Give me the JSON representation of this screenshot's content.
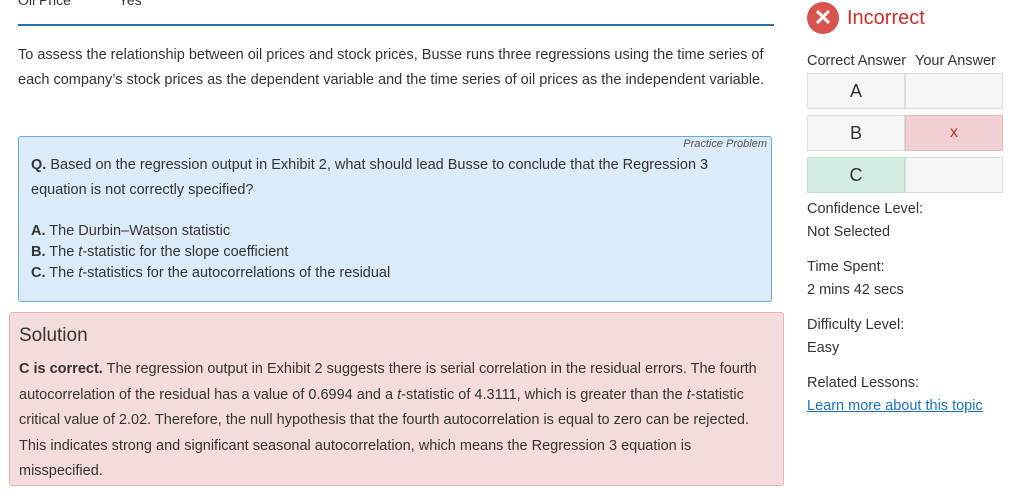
{
  "table_top": {
    "col1": "Oil Price",
    "col2": "Yes"
  },
  "intro": "To assess the relationship between oil prices and stock prices, Busse runs three regressions using the time series of each company’s stock prices as the dependent variable and the time series of oil prices as the independent variable.",
  "question": {
    "tag": "Practice Problem",
    "prefix": "Q.",
    "text": "Based on the regression output in Exhibit 2, what should lead Busse to conclude that the Regression 3 equation is not correctly specified?",
    "options": [
      {
        "letter": "A.",
        "pre": "The Durbin–Watson statistic",
        "t": "",
        "post": ""
      },
      {
        "letter": "B.",
        "pre": "The ",
        "t": "t",
        "post": "-statistic for the slope coefficient"
      },
      {
        "letter": "C.",
        "pre": "The ",
        "t": "t",
        "post": "-statistics for the autocorrelations of the residual"
      }
    ]
  },
  "solution": {
    "title": "Solution",
    "lead": "C is correct.",
    "s1": " The regression output in Exhibit 2 suggests there is serial correlation in the residual errors. The fourth autocorrelation of the residual has a value of 0.6994 and a ",
    "t1": "t",
    "s2": "-statistic of 4.3111, which is greater than the ",
    "t2": "t",
    "s3": "-statistic critical value of 2.02. Therefore, the null hypothesis that the fourth autocorrelation is equal to zero can be rejected. This indicates strong and significant seasonal autocorrelation, which means the Regression 3 equation is misspecified."
  },
  "sidebar": {
    "result": {
      "icon": "✕",
      "label": "Incorrect",
      "color": "#c9302c"
    },
    "correct_header": "Correct Answer",
    "your_header": "Your Answer",
    "answers": [
      {
        "letter": "A",
        "yours": ""
      },
      {
        "letter": "B",
        "yours": "x"
      },
      {
        "letter": "C",
        "yours": ""
      }
    ],
    "confidence_label": "Confidence Level:",
    "confidence_value": "Not Selected",
    "time_label": "Time Spent:",
    "time_value": "2 mins 42 secs",
    "difficulty_label": "Difficulty Level:",
    "difficulty_value": "Easy",
    "lessons_label": "Related Lessons:",
    "lessons_link": "Learn more about this topic"
  }
}
